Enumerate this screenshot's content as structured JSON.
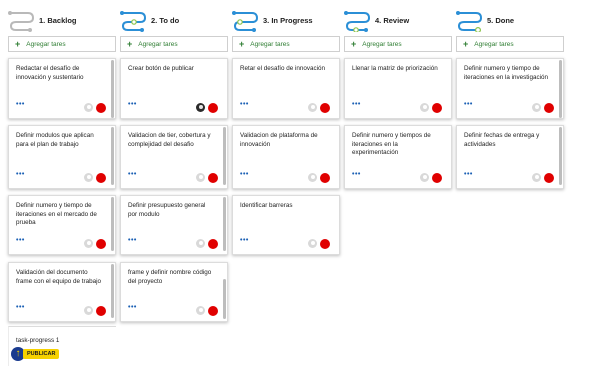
{
  "add_label": "Agregar tares",
  "columns": [
    {
      "title": "1. Backlog",
      "icon_color": "#b9b9b9",
      "cards": [
        {
          "text": "Redactar el desafío de innovación y sustentario",
          "avatar": "gray"
        },
        {
          "text": "Definir modulos que aplican para el plan de trabajo",
          "avatar": "gray"
        },
        {
          "text": "Definir numero y tiempo de iteraciones en el mercado de prueba",
          "avatar": "gray"
        },
        {
          "text": "Validación del documento frame con el equipo de trabajo",
          "avatar": "gray"
        }
      ],
      "last_item": "task-progress 1"
    },
    {
      "title": "2. To do",
      "icon_color": "#2b8fd6",
      "cards": [
        {
          "text": "Crear botón de publicar",
          "avatar": "dark"
        },
        {
          "text": "Validacion de tier, cobertura y complejidad del desafio",
          "avatar": "gray"
        },
        {
          "text": "Definir presupuesto general por modulo",
          "avatar": "gray"
        },
        {
          "text": "frame y definir nombre código del proyecto",
          "avatar": "gray"
        }
      ]
    },
    {
      "title": "3. In Progress",
      "icon_color": "#2b8fd6",
      "cards": [
        {
          "text": "Retar el desafío de innovación",
          "avatar": "gray"
        },
        {
          "text": "Validacion de plataforma de innovación",
          "avatar": "gray"
        },
        {
          "text": "Identificar barreras",
          "avatar": "gray"
        }
      ]
    },
    {
      "title": "4. Review",
      "icon_color": "#2b8fd6",
      "cards": [
        {
          "text": "Llenar la matriz de priorización",
          "avatar": "gray"
        },
        {
          "text": "Definir numero y tiempos de iteraciones en la experimentación",
          "avatar": "gray"
        }
      ]
    },
    {
      "title": "5. Done",
      "icon_color": "#2b8fd6",
      "cards": [
        {
          "text": "Definir numero y tiempo de iteraciones en la investigación",
          "avatar": "gray"
        },
        {
          "text": "Definir fechas de entrega y actividades",
          "avatar": "gray"
        }
      ]
    }
  ],
  "card_more": "•••",
  "publish_label": "PUBLICAR",
  "status_color": "#e00000",
  "accent_color": "#2e7d32"
}
